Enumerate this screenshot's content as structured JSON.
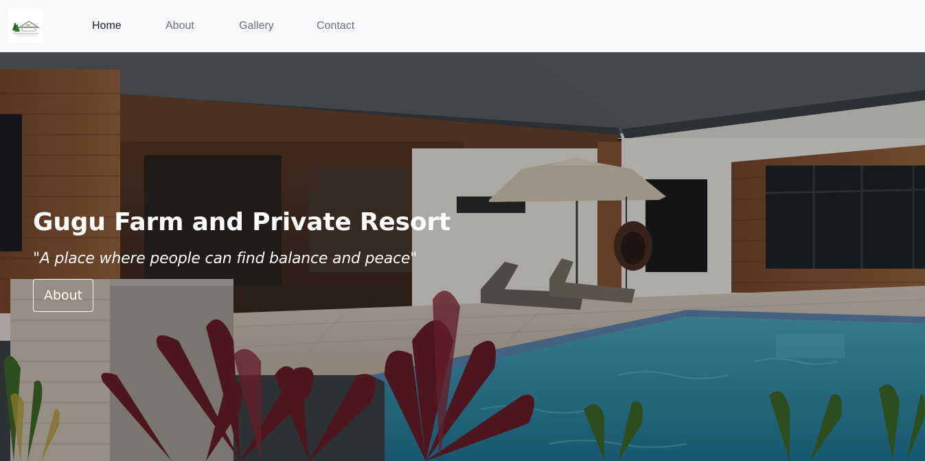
{
  "brand": {
    "logo_icon": "resort-logo-icon"
  },
  "nav": {
    "items": [
      {
        "label": "Home",
        "active": true
      },
      {
        "label": "About",
        "active": false
      },
      {
        "label": "Gallery",
        "active": false
      },
      {
        "label": "Contact",
        "active": false
      }
    ]
  },
  "hero": {
    "title": "Gugu Farm and Private Resort",
    "tagline": "\"A place where people can find balance and peace\"",
    "button_label": "About"
  },
  "colors": {
    "navbar_bg": "#f8f9fa",
    "nav_active": "#1d2124",
    "nav_inactive": "#6c6f73",
    "hero_text": "#ffffff",
    "pool_water": "#2f8fb0"
  }
}
